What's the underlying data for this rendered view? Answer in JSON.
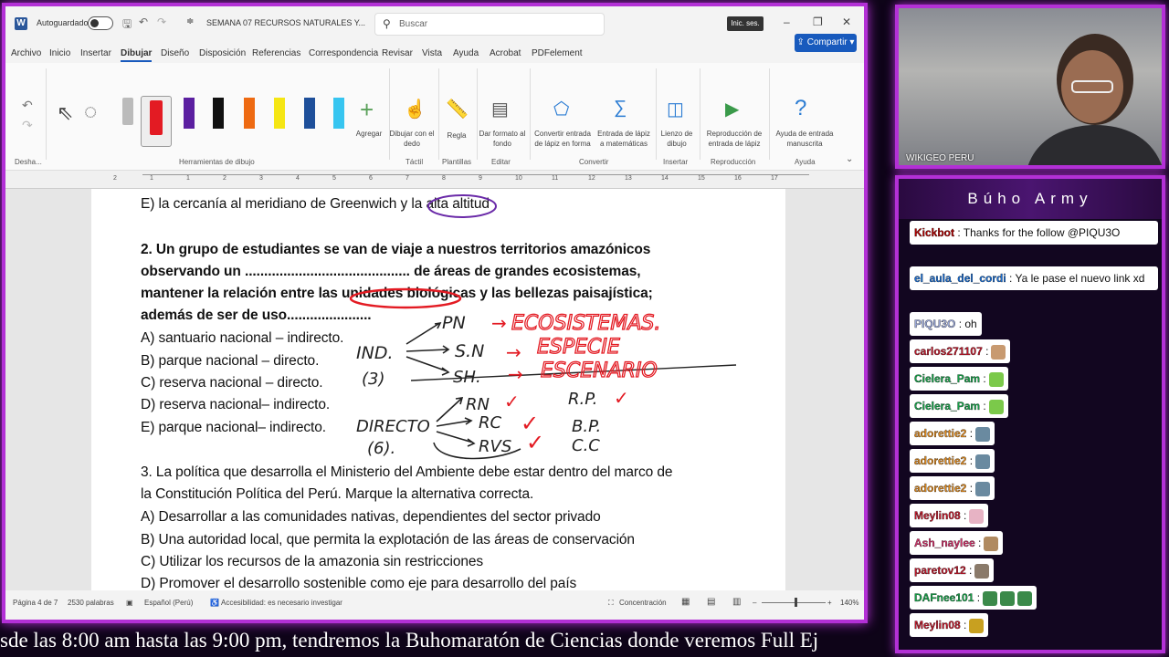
{
  "titlebar": {
    "autosave": "Autoguardado",
    "doc_title": "SEMANA 07 RECURSOS NATURALES Y...",
    "search_placeholder": "Buscar",
    "signin": "Inic. ses."
  },
  "menu": {
    "tabs": [
      "Archivo",
      "Inicio",
      "Insertar",
      "Dibujar",
      "Diseño",
      "Disposición",
      "Referencias",
      "Correspondencia",
      "Revisar",
      "Vista",
      "Ayuda",
      "Acrobat",
      "PDFelement"
    ],
    "share": "Compartir"
  },
  "ribbon": {
    "undo_group": "Desha...",
    "drawing_tools_group": "Herramientas de dibujo",
    "add_label": "Agregar",
    "draw_finger": "Dibujar con el dedo",
    "ruler": "Regla",
    "format_background": "Dar formato al fondo",
    "convert_ink": "Convertir entrada de lápiz en forma",
    "math_ink": "Entrada de lápiz a matemáticas",
    "ink_canvas": "Lienzo de dibujo",
    "ink_replay": "Reproducción de entrada de lápiz",
    "ink_help": "Ayuda de entrada manuscrita",
    "groups": {
      "tactil": "Táctil",
      "plantillas": "Plantillas",
      "editar": "Editar",
      "convertir": "Convertir",
      "insertar": "Insertar",
      "reproduccion": "Reproducción",
      "ayuda": "Ayuda"
    }
  },
  "ruler_ticks": [
    "2",
    "1",
    "1",
    "2",
    "3",
    "4",
    "5",
    "6",
    "7",
    "8",
    "9",
    "10",
    "11",
    "12",
    "13",
    "14",
    "15",
    "16",
    "17"
  ],
  "document": {
    "line_e1": "E) la cercanía al meridiano de Greenwich y la alta altitud",
    "q2_l1": "2. Un grupo de estudiantes se van de viaje a nuestros territorios amazónicos",
    "q2_l2": "observando un ........................................... de áreas de grandes ecosistemas,",
    "q2_l3": "mantener la relación entre las unidades biológicas y las bellezas paisajística;",
    "q2_l4": "además de ser de uso......................",
    "q2_a": "A) santuario nacional – indirecto.",
    "q2_b": "B) parque nacional – directo.",
    "q2_c": "C) reserva nacional – directo.",
    "q2_d": "D) reserva nacional– indirecto.",
    "q2_e": "E) parque nacional– indirecto.",
    "q3_l1": "3. La política que desarrolla el Ministerio del Ambiente debe estar dentro del marco de",
    "q3_l2": "la Constitución Política del Perú. Marque la alternativa correcta.",
    "q3_a": "A) Desarrollar a las comunidades nativas, dependientes del sector privado",
    "q3_b": "B) Una autoridad local, que permita la explotación de las áreas de conservación",
    "q3_c": "C) Utilizar los recursos de la amazonia sin restricciones",
    "q3_d": "D) Promover el desarrollo sostenible como eje para desarrollo del país"
  },
  "ink": {
    "pn": "PN",
    "ecosistemas": "ECOSISTEMAS.",
    "ind": "IND.",
    "three": "(3)",
    "sn": "S.N",
    "especie": "ESPECIE",
    "sh": "SH.",
    "escenario": "ESCENARIO",
    "directo": "DIRECTO",
    "six": "(6).",
    "rn": "RN",
    "rc": "RC",
    "rvs": "RVS",
    "rp": "R.P.",
    "bp": "B.P.",
    "cc": "C.C"
  },
  "status": {
    "page": "Página 4 de 7",
    "words": "2530 palabras",
    "lang": "Español (Perú)",
    "access": "Accesibilidad: es necesario investigar",
    "focus": "Concentración",
    "zoom": "140%"
  },
  "ticker": "sde las 8:00 am hasta las 9:00 pm, tendremos la Buhomaratón de Ciencias donde veremos Full Ej",
  "camera": {
    "label": "WIKIGEO PERU"
  },
  "chat": {
    "title": "Búho Army",
    "messages": [
      {
        "user": "Kickbot",
        "text": ": Thanks for the follow @PIQU3O",
        "color": "#b00000"
      },
      {
        "user": "el_aula_del_cordi",
        "text": ": Ya le pase el nuevo link xd",
        "color": "#1a6fd6"
      },
      {
        "user": "PIQU3O",
        "text": ": oh",
        "color": "#9aa8d8"
      },
      {
        "user": "carlos271107",
        "text": ":",
        "color": "#c0182b"
      },
      {
        "user": "Cielera_Pam",
        "text": ":",
        "color": "#17a34a"
      },
      {
        "user": "Cielera_Pam",
        "text": ":",
        "color": "#17a34a"
      },
      {
        "user": "adorettie2",
        "text": ":",
        "color": "#e08a1e"
      },
      {
        "user": "adorettie2",
        "text": ":",
        "color": "#e08a1e"
      },
      {
        "user": "adorettie2",
        "text": ":",
        "color": "#e08a1e"
      },
      {
        "user": "Meylin08",
        "text": ":",
        "color": "#c0182b"
      },
      {
        "user": "Ash_naylee",
        "text": ":",
        "color": "#d6336c"
      },
      {
        "user": "paretov12",
        "text": ":",
        "color": "#c0182b"
      },
      {
        "user": "DAFnee101",
        "text": ":",
        "color": "#17a34a"
      },
      {
        "user": "Meylin08",
        "text": ":",
        "color": "#c0182b"
      }
    ]
  }
}
